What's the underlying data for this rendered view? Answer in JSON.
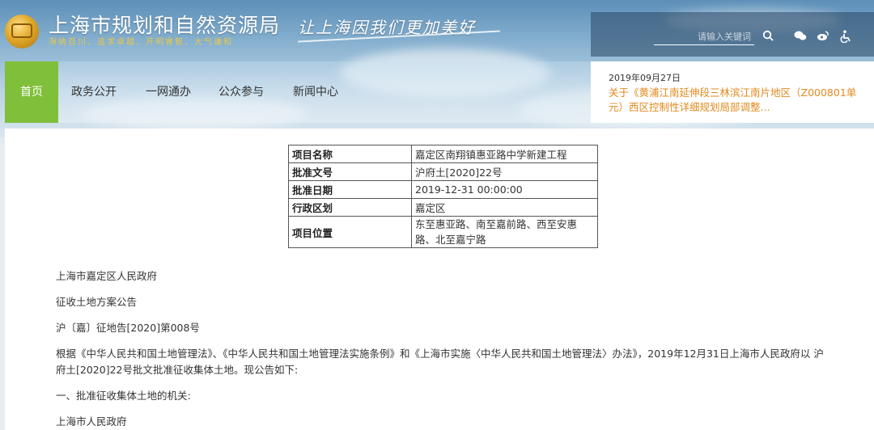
{
  "header": {
    "title": "上海市规划和自然资源局",
    "subtitle": "海纳百川、追求卓越、开明睿智、大气谦和",
    "slogan": "让上海因我们更加美好"
  },
  "search": {
    "placeholder": "请输入关键词"
  },
  "toolbar": {
    "icons": [
      "search-icon",
      "wechat-icon",
      "weibo-icon",
      "accessibility-icon"
    ]
  },
  "nav": {
    "items": [
      {
        "label": "首页",
        "active": true
      },
      {
        "label": "政务公开"
      },
      {
        "label": "一网通办"
      },
      {
        "label": "公众参与"
      },
      {
        "label": "新闻中心"
      }
    ],
    "active_color": "#7fbf3a"
  },
  "news": {
    "date": "2019年09月27日",
    "title": "关于《黄浦江南延伸段三林滨江南片地区（Z000801单元）西区控制性详细规划局部调整...",
    "color": "#e18a1d"
  },
  "info_table": {
    "rows": [
      {
        "key": "项目名称",
        "value": "嘉定区南翔镇惠亚路中学新建工程"
      },
      {
        "key": "批准文号",
        "value": "沪府土[2020]22号"
      },
      {
        "key": "批准日期",
        "value": "2019-12-31 00:00:00"
      },
      {
        "key": "行政区划",
        "value": "嘉定区"
      },
      {
        "key": "项目位置",
        "value": "东至惠亚路、南至嘉前路、西至安惠路、北至嘉宁路"
      }
    ]
  },
  "body": {
    "p1": "上海市嘉定区人民政府",
    "p2": "征收土地方案公告",
    "p3": "沪〔嘉〕征地告[2020]第008号",
    "p4": "根据《中华人民共和国土地管理法》、《中华人民共和国土地管理法实施条例》和《上海市实施〈中华人民共和国土地管理法〉办法》，2019年12月31日上海市人民政府以 沪府土[2020]22号批文批准征收集体土地。现公告如下:",
    "p5": "一、批准征收集体土地的机关:",
    "p6": "上海市人民政府"
  }
}
